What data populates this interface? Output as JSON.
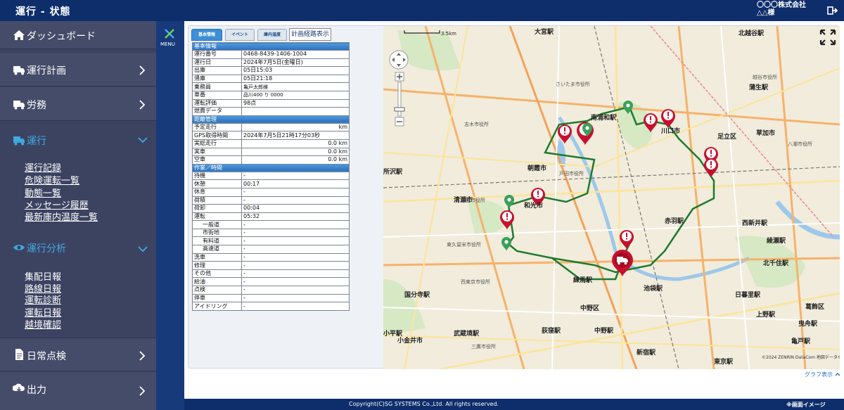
{
  "header": {
    "title": "運行 - 状態",
    "company_line1": "〇〇〇株式会社",
    "company_line2": "△△様",
    "logout_icon": "logout-icon"
  },
  "sidebar": {
    "items": [
      {
        "label": "ダッシュボード",
        "icon": "home-icon"
      },
      {
        "label": "運行計画",
        "icon": "truck-icon"
      },
      {
        "label": "労務",
        "icon": "truck-icon"
      },
      {
        "label": "運行",
        "icon": "truck-icon"
      },
      {
        "label": "運行分析",
        "icon": "eye-icon"
      },
      {
        "label": "日常点検",
        "icon": "document-icon"
      },
      {
        "label": "出力",
        "icon": "download-icon"
      }
    ],
    "operation_links": [
      "運行記録",
      "危険運転一覧",
      "動態一覧",
      "メッセージ履歴",
      "最新庫内温度一覧"
    ],
    "analysis_links": [
      "集配日報",
      "路線日報",
      "運転診断",
      "運転日報",
      "越境確認"
    ],
    "active_color": "#3fa9e0"
  },
  "menu": {
    "label": "MENU"
  },
  "tabs": {
    "basic": "基本情報",
    "event": "イベント",
    "temp": "庫内温度",
    "plan_route": "計画経路表示"
  },
  "table": {
    "basic_header": "基本情報",
    "basic_rows": [
      {
        "k": "運行番号",
        "v": "0468-8439-1406-1004"
      },
      {
        "k": "運行日",
        "v": "2024年7月5日(金曜日)"
      },
      {
        "k": "出庫",
        "v": "05日15:03"
      },
      {
        "k": "帰庫",
        "v": "05日21:18"
      },
      {
        "k": "乗務員",
        "v": "亀戸太郎様"
      },
      {
        "k": "車番",
        "v": "品川400 り 0000"
      },
      {
        "k": "運転評価",
        "v": "98点"
      },
      {
        "k": "燃費データ",
        "v": ""
      }
    ],
    "distance_header": "距離管理",
    "distance_rows": [
      {
        "k": "予定走行",
        "v": "km"
      },
      {
        "k": "GPS取得時間",
        "v": "2024年7月5日21時17分03秒"
      },
      {
        "k": "実総走行",
        "v": "0.0 km"
      },
      {
        "k": "実車",
        "v": "0.0 km"
      },
      {
        "k": "空車",
        "v": "0.0 km"
      }
    ],
    "work_header": "作業／時間",
    "work_rows": [
      {
        "k": "待機",
        "v": "-"
      },
      {
        "k": "休憩",
        "v": "00:17"
      },
      {
        "k": "休息",
        "v": "-"
      },
      {
        "k": "荷積",
        "v": "-"
      },
      {
        "k": "荷卸",
        "v": "00:04"
      },
      {
        "k": "運転",
        "v": "05:32"
      },
      {
        "k": "一般道",
        "v": "-"
      },
      {
        "k": "市街地",
        "v": "-"
      },
      {
        "k": "有料道",
        "v": "-"
      },
      {
        "k": "高速道",
        "v": "-"
      },
      {
        "k": "洗車",
        "v": "-"
      },
      {
        "k": "修理",
        "v": "-"
      },
      {
        "k": "その他",
        "v": "-"
      },
      {
        "k": "給油",
        "v": "-"
      },
      {
        "k": "点検",
        "v": "-"
      },
      {
        "k": "停車",
        "v": "-"
      },
      {
        "k": "アイドリング",
        "v": "-"
      }
    ]
  },
  "map": {
    "scale_label": "3.5km",
    "labels": [
      "大宮駅",
      "北越谷駅",
      "蒲生駅",
      "南浦和駅",
      "川口市",
      "草加市",
      "朝霞市",
      "清瀬市",
      "和光市",
      "赤羽駅",
      "西新井駅",
      "綾瀬駅",
      "北千住駅",
      "練馬駅",
      "池袋駅",
      "日暮里駅",
      "中野区",
      "上野駅",
      "小平駅",
      "小金井市",
      "武蔵境駅",
      "荻窪駅",
      "中野駅",
      "新宿駅",
      "東京駅",
      "亀戸駅",
      "曳舟駅",
      "葛飾区",
      "志木市役所",
      "所沢駅",
      "新座市役所",
      "東久留米市役所",
      "西東京市役所",
      "戸田市役所",
      "さいたま市役所",
      "足立区",
      "越谷市役所",
      "八潮市役所",
      "三鷹市役所",
      "国分寺駅"
    ],
    "copyright": "©2024 ZENRIN DataCom 地図データ©2024 ZENRIN",
    "route_color": "#1e7a2e",
    "warning_color": "#c8102e",
    "start_color": "#3aa05a"
  },
  "graph_link": "グラフ表示",
  "footer": {
    "copyright": "Copyright(C)SG SYSTEMS Co.,Ltd. All rights reserved.",
    "note": "※画面イメージ"
  }
}
